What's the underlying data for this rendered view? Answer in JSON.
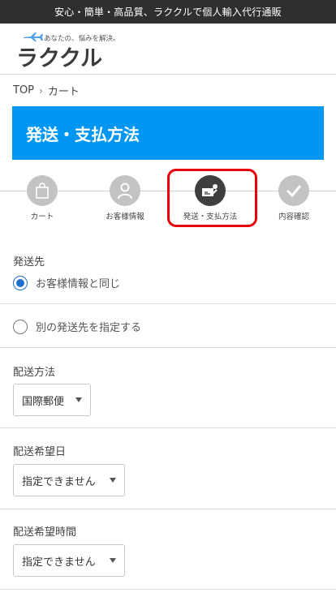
{
  "topbar": {
    "text": "安心・簡単・高品質、ラククルで個人輸入代行通販"
  },
  "logo": {
    "tagline": "あなたの、悩みを解決。",
    "wordmark": "ラククル"
  },
  "breadcrumb": {
    "items": [
      "TOP",
      "カート"
    ],
    "separator": "›"
  },
  "page": {
    "title": "発送・支払方法"
  },
  "steps": [
    {
      "label": "カート",
      "icon": "shopping-bag-icon",
      "active": false
    },
    {
      "label": "お客様情報",
      "icon": "user-icon",
      "active": false
    },
    {
      "label": "発送・支払方法",
      "icon": "shipping-payment-icon",
      "active": true
    },
    {
      "label": "内容確認",
      "icon": "checkmark-icon",
      "active": false
    }
  ],
  "shipping_destination": {
    "label": "発送先",
    "options": [
      {
        "label": "お客様情報と同じ",
        "selected": true
      },
      {
        "label": "別の発送先を指定する",
        "selected": false
      }
    ]
  },
  "delivery_method": {
    "label": "配送方法",
    "value": "国際郵便"
  },
  "delivery_date": {
    "label": "配送希望日",
    "value": "指定できません"
  },
  "delivery_time": {
    "label": "配送希望時間",
    "value": "指定できません"
  },
  "colors": {
    "accent": "#0097f2",
    "highlight": "#e8000b",
    "radio": "#1f6fd1",
    "topbar": "#2f2f2f"
  }
}
